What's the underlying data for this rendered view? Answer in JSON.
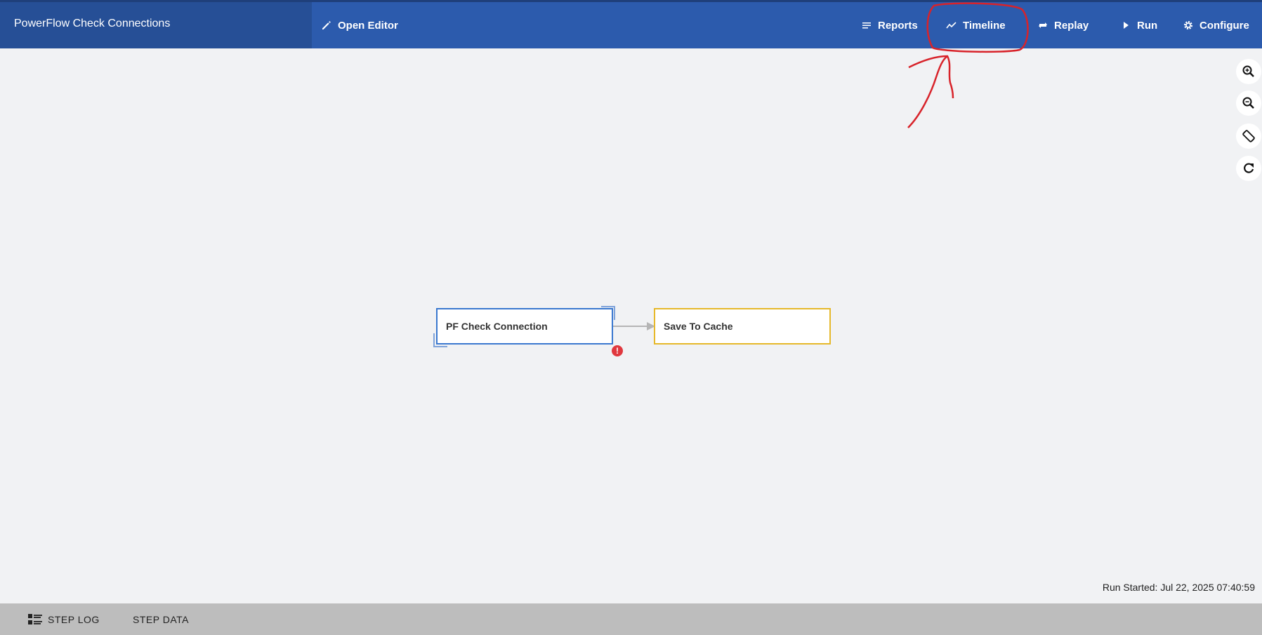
{
  "app": {
    "title": "PowerFlow Check Connections"
  },
  "toolbar": {
    "open_editor": "Open Editor",
    "reports": "Reports",
    "timeline": "Timeline",
    "replay": "Replay",
    "run": "Run",
    "configure": "Configure"
  },
  "diagram": {
    "nodes": [
      {
        "label": "PF Check Connection",
        "status": "error"
      },
      {
        "label": "Save To Cache",
        "status": "pending"
      }
    ],
    "error_badge": "!"
  },
  "status": {
    "run_started": "Run Started: Jul 22, 2025 07:40:59"
  },
  "bottom_tabs": {
    "step_log": "STEP LOG",
    "step_data": "STEP DATA"
  },
  "colors": {
    "topbar": "#2c5bad",
    "title_area": "#264f96",
    "node_selected": "#3a78cf",
    "node_pending": "#e6b82a",
    "error": "#e0383e",
    "annotation": "#d8232a"
  }
}
